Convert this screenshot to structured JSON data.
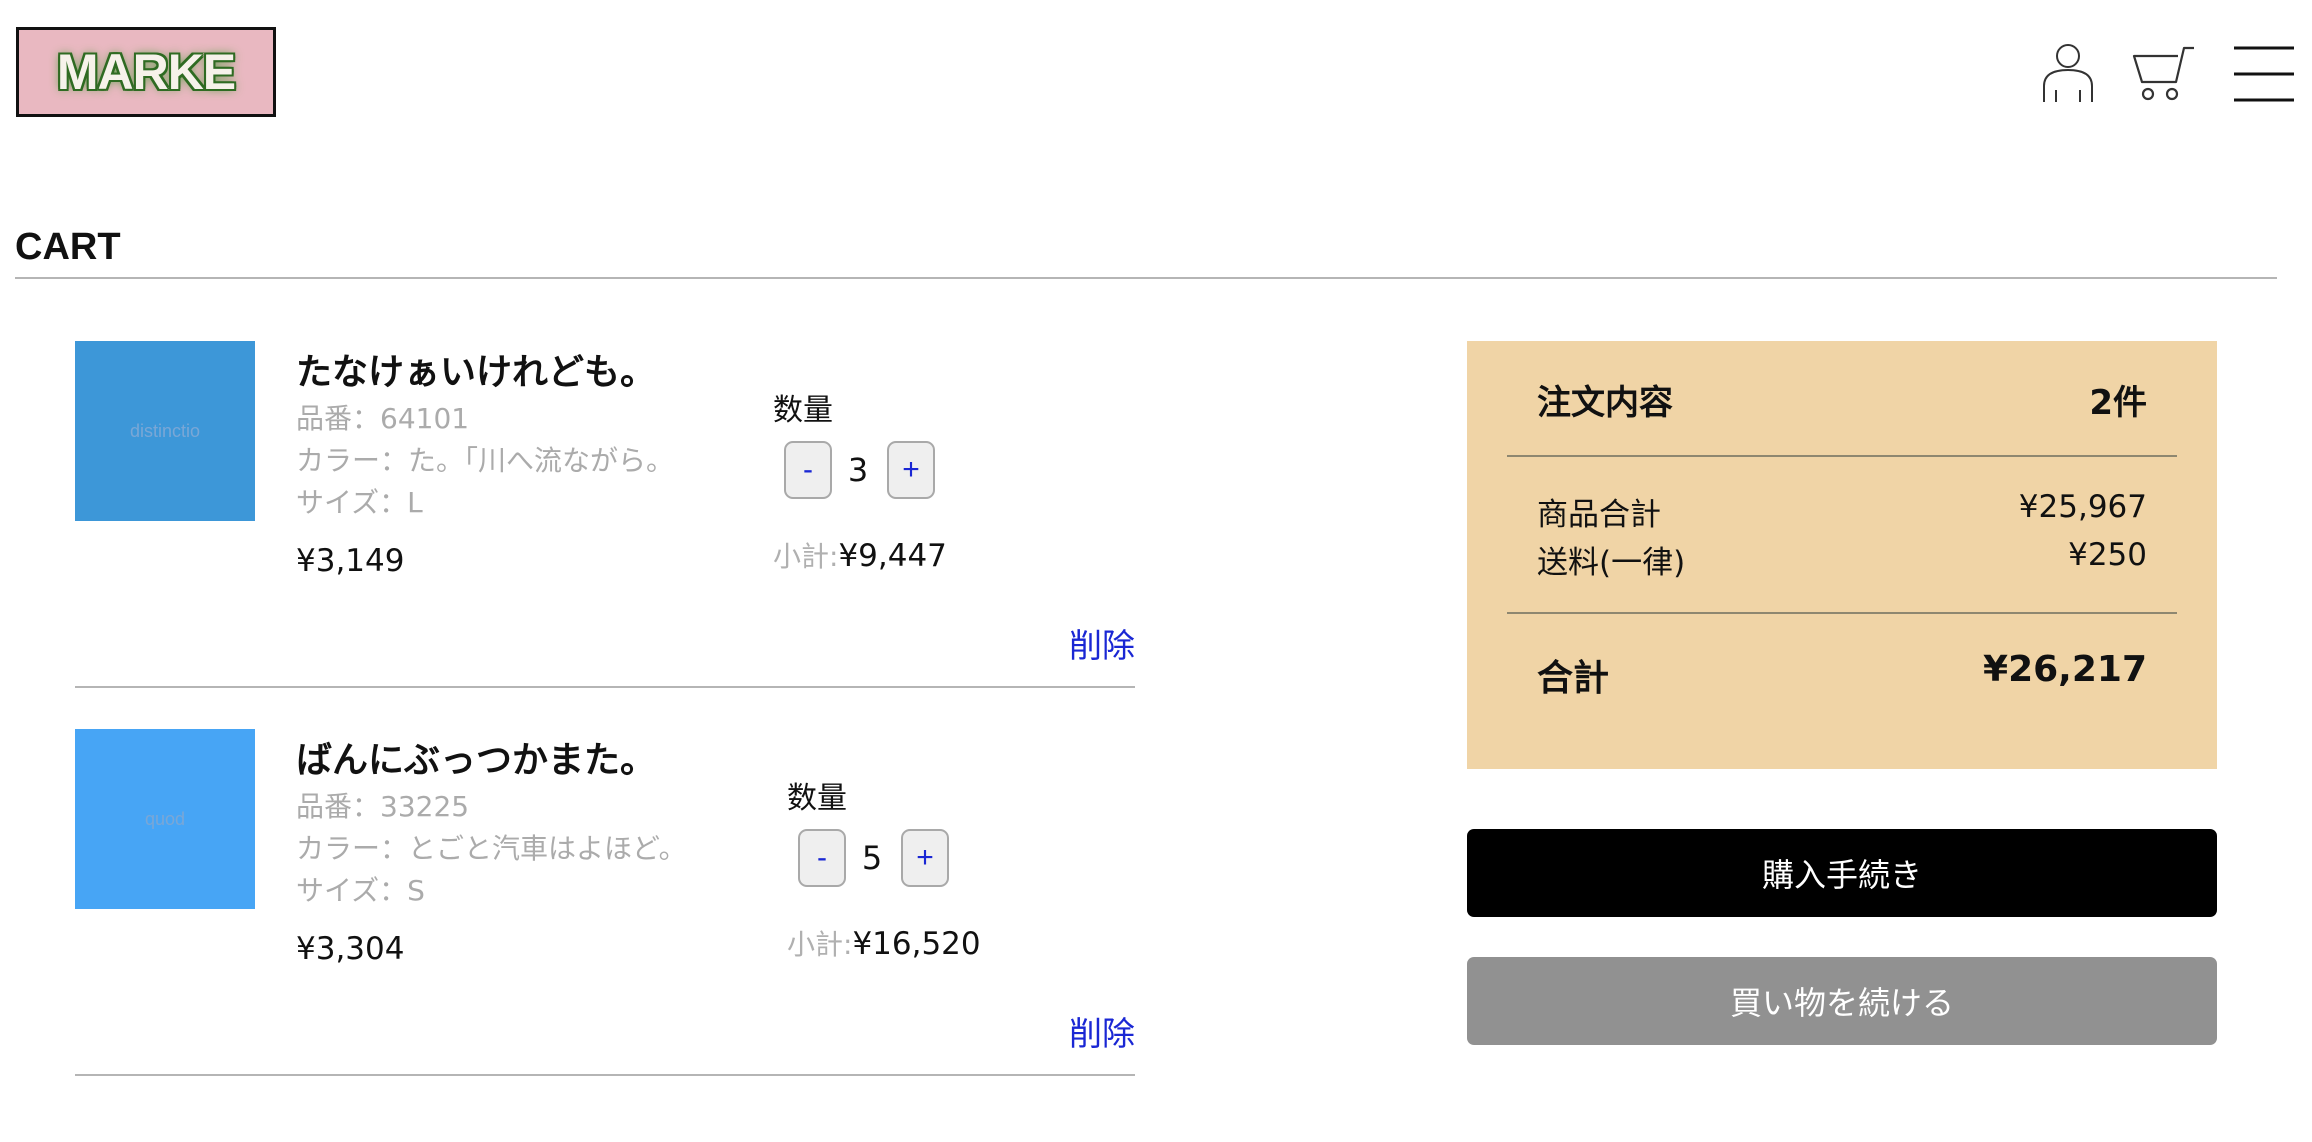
{
  "header": {
    "logo_text": "MARKE",
    "icons": [
      "user-icon",
      "cart-icon",
      "hamburger-menu-icon"
    ]
  },
  "page": {
    "title": "CART"
  },
  "cart": {
    "items": [
      {
        "image_text": "distinctio",
        "image_color": "#3d97d8",
        "name": "たなけぁいけれども。",
        "code": "品番：64101",
        "color": "カラー：た。｢川へ流ながら。",
        "size": "サイズ：L",
        "price": "¥3,149",
        "qty_label": "数量",
        "qty_minus": "-",
        "qty": "3",
        "qty_plus": "+",
        "subtotal_label": "小計:",
        "subtotal": "¥9,447",
        "delete_label": "削除"
      },
      {
        "image_text": "quod",
        "image_color": "#47a5f5",
        "name": "ばんにぶっつかまた。",
        "code": "品番：33225",
        "color": "カラー：とごと汽車はよほど。",
        "size": "サイズ：S",
        "price": "¥3,304",
        "qty_label": "数量",
        "qty_minus": "-",
        "qty": "5",
        "qty_plus": "+",
        "subtotal_label": "小計:",
        "subtotal": "¥16,520",
        "delete_label": "削除"
      }
    ]
  },
  "summary": {
    "heading": "注文内容",
    "count": "2件",
    "items_total_label": "商品合計",
    "items_total": "¥25,967",
    "shipping_label": "送料(一律)",
    "shipping": "¥250",
    "total_label": "合計",
    "total": "¥26,217",
    "background": "#f0d4a6"
  },
  "actions": {
    "checkout_label": "購入手続き",
    "continue_label": "買い物を続ける"
  }
}
